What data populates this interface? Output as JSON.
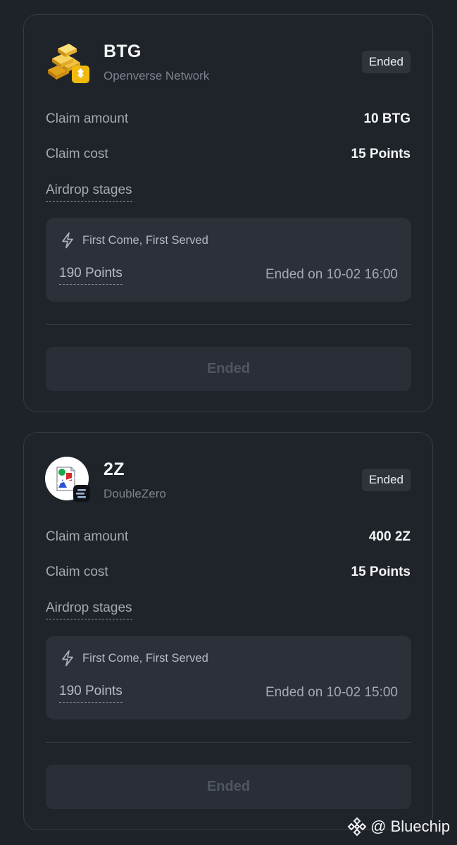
{
  "airdrops": [
    {
      "token_symbol": "BTG",
      "network": "Openverse Network",
      "status_badge": "Ended",
      "claim_amount_label": "Claim amount",
      "claim_amount_value": "10 BTG",
      "claim_cost_label": "Claim cost",
      "claim_cost_value": "15 Points",
      "stages_label": "Airdrop stages",
      "stage": {
        "type": "First Come, First Served",
        "points": "190 Points",
        "end_time": "Ended on 10-02 16:00"
      },
      "button_label": "Ended",
      "icon": "gold-bars-icon"
    },
    {
      "token_symbol": "2Z",
      "network": "DoubleZero",
      "status_badge": "Ended",
      "claim_amount_label": "Claim amount",
      "claim_amount_value": "400 2Z",
      "claim_cost_label": "Claim cost",
      "claim_cost_value": "15 Points",
      "stages_label": "Airdrop stages",
      "stage": {
        "type": "First Come, First Served",
        "points": "190 Points",
        "end_time": "Ended on 10-02 15:00"
      },
      "button_label": "Ended",
      "icon": "broken-image-icon"
    }
  ],
  "watermark": {
    "text": "@ Bluechip",
    "icon": "binance-logo-icon"
  },
  "colors": {
    "background": "#1e2229",
    "card_border": "#363b44",
    "stage_box": "#2b3039",
    "gold": "#f0b90b"
  }
}
